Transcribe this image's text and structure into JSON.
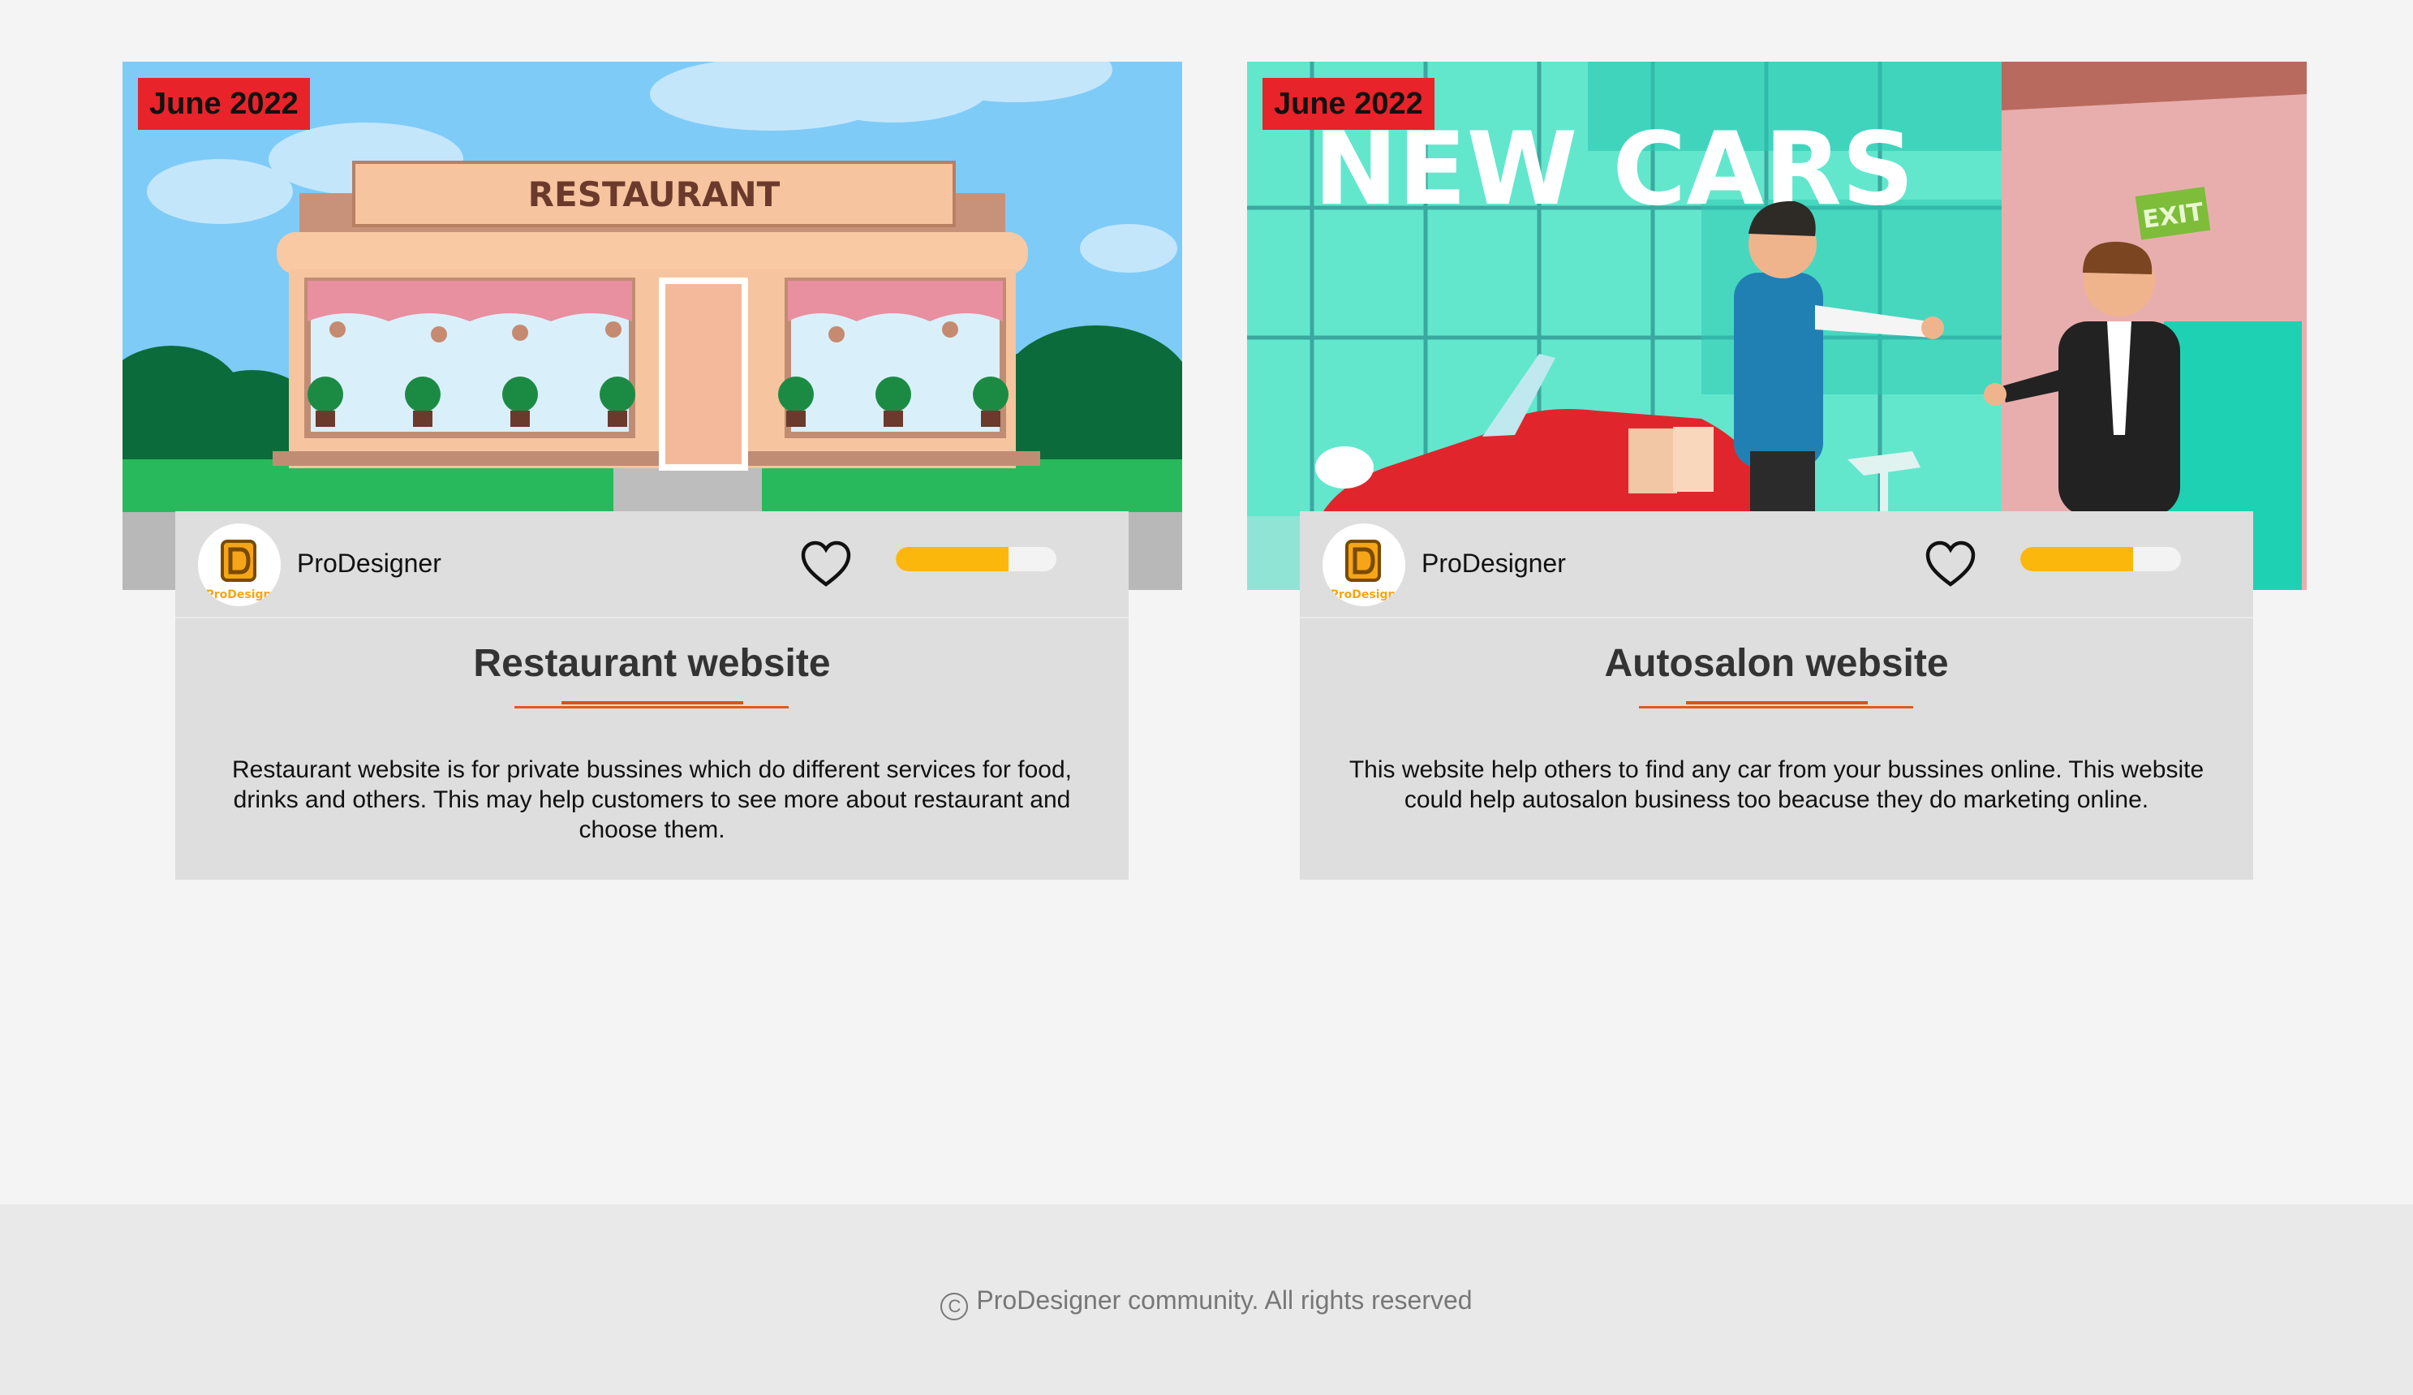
{
  "cards": [
    {
      "date": "June 2022",
      "image_alt": "restaurant-illustration",
      "sign_text": "RESTAURANT",
      "author": "ProDesigner",
      "rating_fraction": 0.7,
      "title": "Restaurant website",
      "description": "Restaurant website is for private bussines which do different services for food, drinks and others. This may help customers to see more about restaurant and choose them."
    },
    {
      "date": "June 2022",
      "image_alt": "car-dealership-illustration",
      "sign_text": "NEW CARS",
      "exit_text": "EXIT",
      "author": "ProDesigner",
      "rating_fraction": 0.7,
      "title": "Autosalon website",
      "description": "This website help others to find any car from your bussines online. This website could help autosalon business too beacuse they do marketing online."
    }
  ],
  "footer": {
    "copyright_symbol": "C",
    "text": "ProDesigner community. All rights reserved"
  },
  "colors": {
    "badge": "#e8232a",
    "progress": "#fbb70c",
    "underline": "#e05a1c",
    "card_bg": "#dedede"
  }
}
